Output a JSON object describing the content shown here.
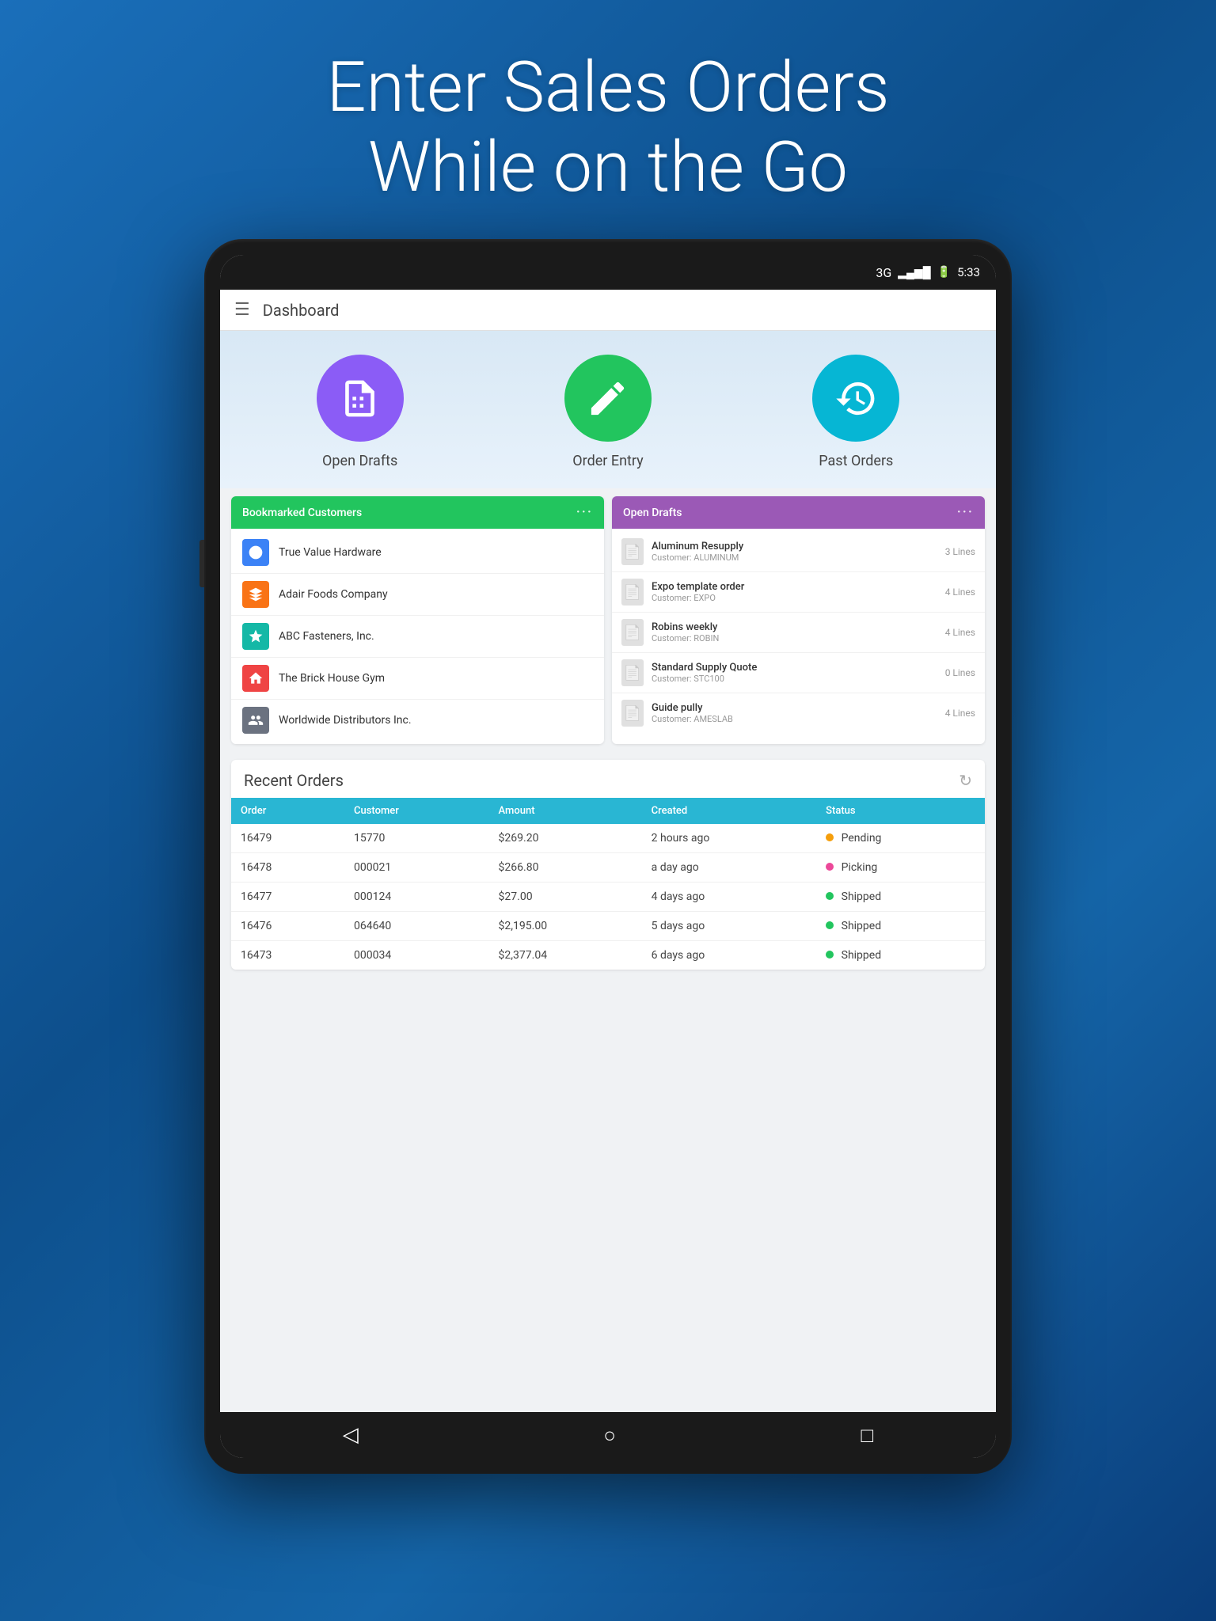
{
  "hero": {
    "line1": "Enter Sales Orders",
    "line2": "While on the Go"
  },
  "statusBar": {
    "signal": "3G",
    "time": "5:33"
  },
  "navBar": {
    "title": "Dashboard",
    "menuIcon": "☰"
  },
  "actions": [
    {
      "id": "open-drafts",
      "label": "Open Drafts",
      "colorClass": "circle-purple",
      "icon": "📋"
    },
    {
      "id": "order-entry",
      "label": "Order Entry",
      "colorClass": "circle-green",
      "icon": "✏️"
    },
    {
      "id": "past-orders",
      "label": "Past Orders",
      "colorClass": "circle-cyan",
      "icon": "🕐"
    }
  ],
  "bookmarkedCustomers": {
    "header": "Bookmarked Customers",
    "dotsLabel": "···",
    "customers": [
      {
        "name": "True Value Hardware",
        "colorClass": "logo-blue"
      },
      {
        "name": "Adair Foods Company",
        "colorClass": "logo-orange"
      },
      {
        "name": "ABC Fasteners, Inc.",
        "colorClass": "logo-teal"
      },
      {
        "name": "The Brick House Gym",
        "colorClass": "logo-red"
      },
      {
        "name": "Worldwide Distributors Inc.",
        "colorClass": "logo-gray"
      }
    ]
  },
  "openDrafts": {
    "header": "Open Drafts",
    "dotsLabel": "···",
    "drafts": [
      {
        "name": "Aluminum Resupply",
        "customer": "Customer: ALUMINUM",
        "lines": "3 Lines"
      },
      {
        "name": "Expo template order",
        "customer": "Customer: EXPO",
        "lines": "4 Lines"
      },
      {
        "name": "Robins weekly",
        "customer": "Customer: ROBIN",
        "lines": "4 Lines"
      },
      {
        "name": "Standard Supply Quote",
        "customer": "Customer: STC100",
        "lines": "0 Lines"
      },
      {
        "name": "Guide pully",
        "customer": "Customer: AMESLAB",
        "lines": "4 Lines"
      }
    ]
  },
  "recentOrders": {
    "title": "Recent Orders",
    "columns": [
      "Order",
      "Customer",
      "Amount",
      "Created",
      "Status"
    ],
    "rows": [
      {
        "order": "16479",
        "customer": "15770",
        "amount": "$269.20",
        "created": "2 hours ago",
        "status": "Pending",
        "statusType": "yellow"
      },
      {
        "order": "16478",
        "customer": "000021",
        "amount": "$266.80",
        "created": "a day ago",
        "status": "Picking",
        "statusType": "pink"
      },
      {
        "order": "16477",
        "customer": "000124",
        "amount": "$27.00",
        "created": "4 days ago",
        "status": "Shipped",
        "statusType": "green"
      },
      {
        "order": "16476",
        "customer": "064640",
        "amount": "$2,195.00",
        "created": "5 days ago",
        "status": "Shipped",
        "statusType": "green"
      },
      {
        "order": "16473",
        "customer": "000034",
        "amount": "$2,377.04",
        "created": "6 days ago",
        "status": "Shipped",
        "statusType": "green"
      }
    ]
  },
  "bottomNav": {
    "back": "◁",
    "home": "○",
    "recent": "□"
  }
}
